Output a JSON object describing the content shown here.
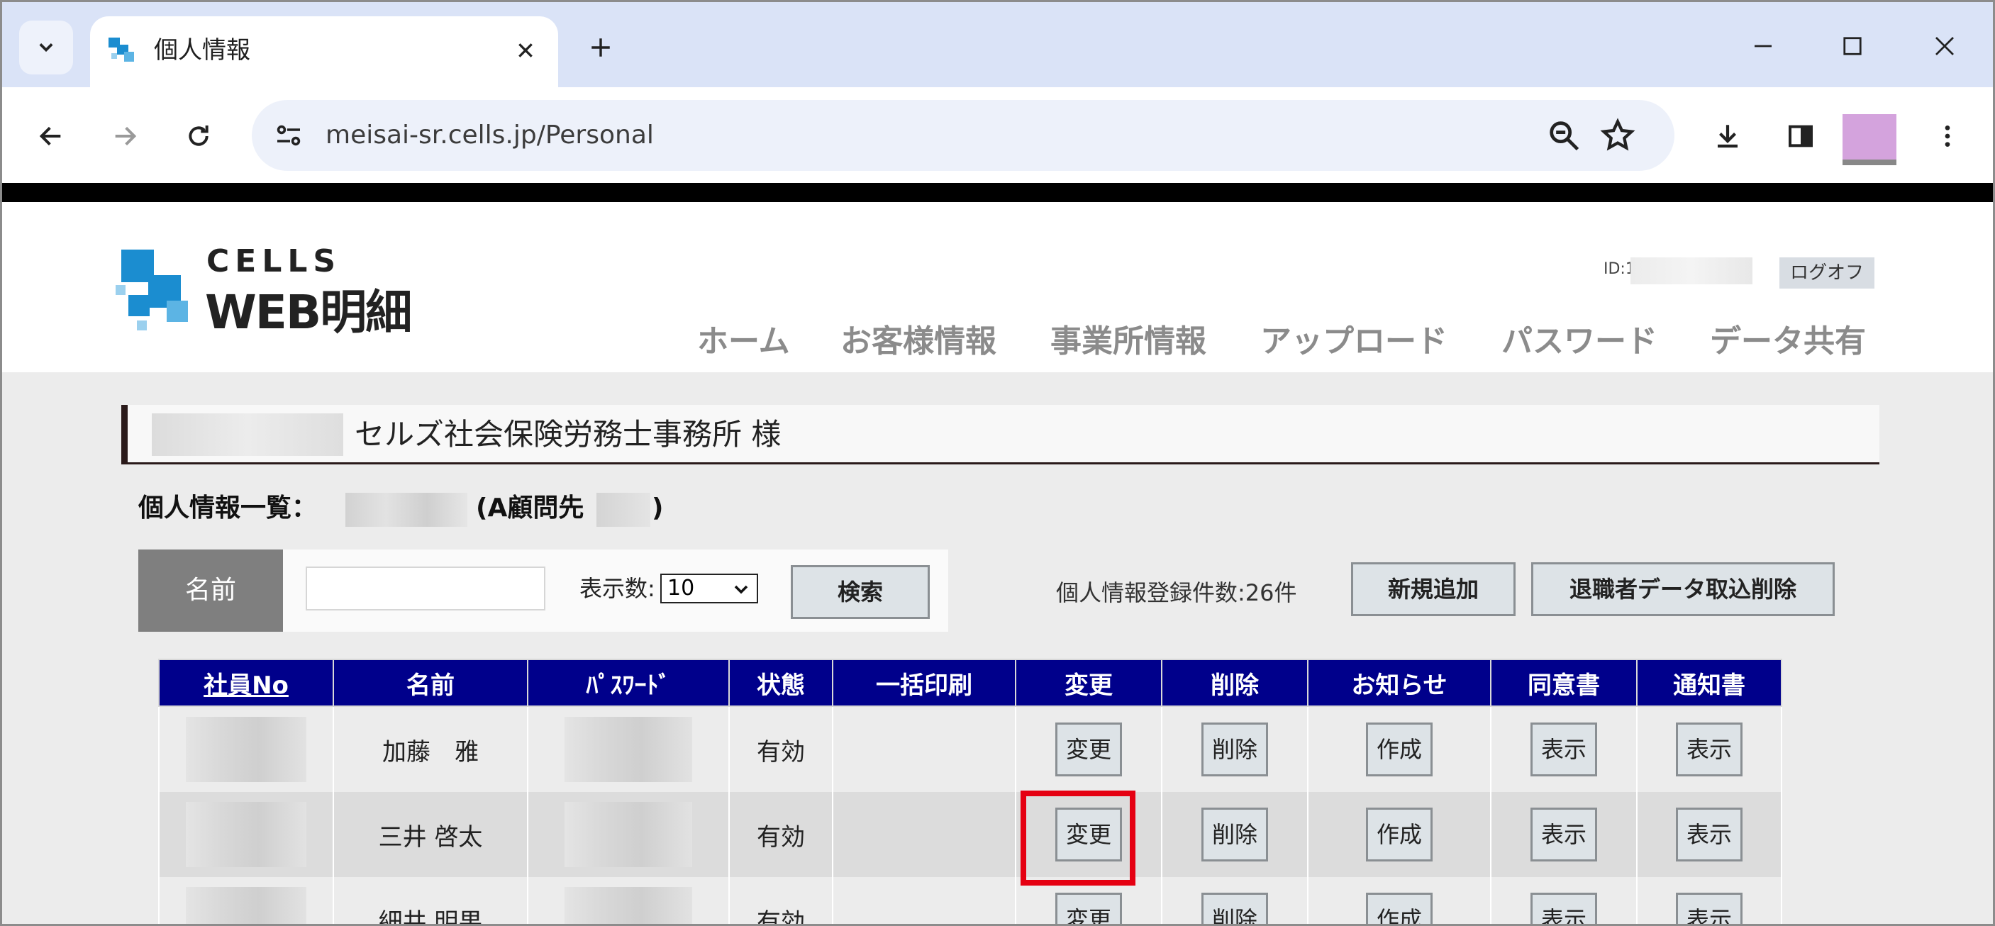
{
  "browser": {
    "tab_title": "個人情報",
    "url": "meisai-sr.cells.jp/Personal"
  },
  "site": {
    "logo_top": "CELLS",
    "logo_main": "WEB明細",
    "user_id_prefix": "ID:1",
    "logout": "ログオフ",
    "nav": [
      "ホーム",
      "お客様情報",
      "事業所情報",
      "アップロード",
      "パスワード",
      "データ共有"
    ]
  },
  "client": {
    "name_suffix": "セルズ社会保険労務士事務所 様"
  },
  "list": {
    "title_prefix": "個人情報一覧：",
    "title_mid": "(A顧問先",
    "title_end": ")"
  },
  "search": {
    "label": "名前",
    "input_value": "",
    "count_label": "表示数:",
    "count_value": "10",
    "search_button": "検索"
  },
  "registration_count": "個人情報登録件数:26件",
  "actions": {
    "add_new": "新規追加",
    "delete_retired": "退職者データ取込削除"
  },
  "table": {
    "headers": [
      "社員No",
      "名前",
      "ﾊﾟｽﾜｰﾄﾞ",
      "状態",
      "一括印刷",
      "変更",
      "削除",
      "お知らせ",
      "同意書",
      "通知書"
    ],
    "rows": [
      {
        "name": "加藤　雅",
        "status": "有効",
        "change": "変更",
        "delete": "削除",
        "notice": "作成",
        "consent": "表示",
        "notification": "表示"
      },
      {
        "name": "三井 啓太",
        "status": "有効",
        "change": "変更",
        "delete": "削除",
        "notice": "作成",
        "consent": "表示",
        "notification": "表示"
      },
      {
        "name": "細井 明果",
        "status": "有効",
        "change": "変更",
        "delete": "削除",
        "notice": "作成",
        "consent": "表示",
        "notification": "表示"
      }
    ]
  },
  "colors": {
    "table_header": "#00008b",
    "highlight": "#e50012",
    "tabbar": "#dae3f7"
  }
}
